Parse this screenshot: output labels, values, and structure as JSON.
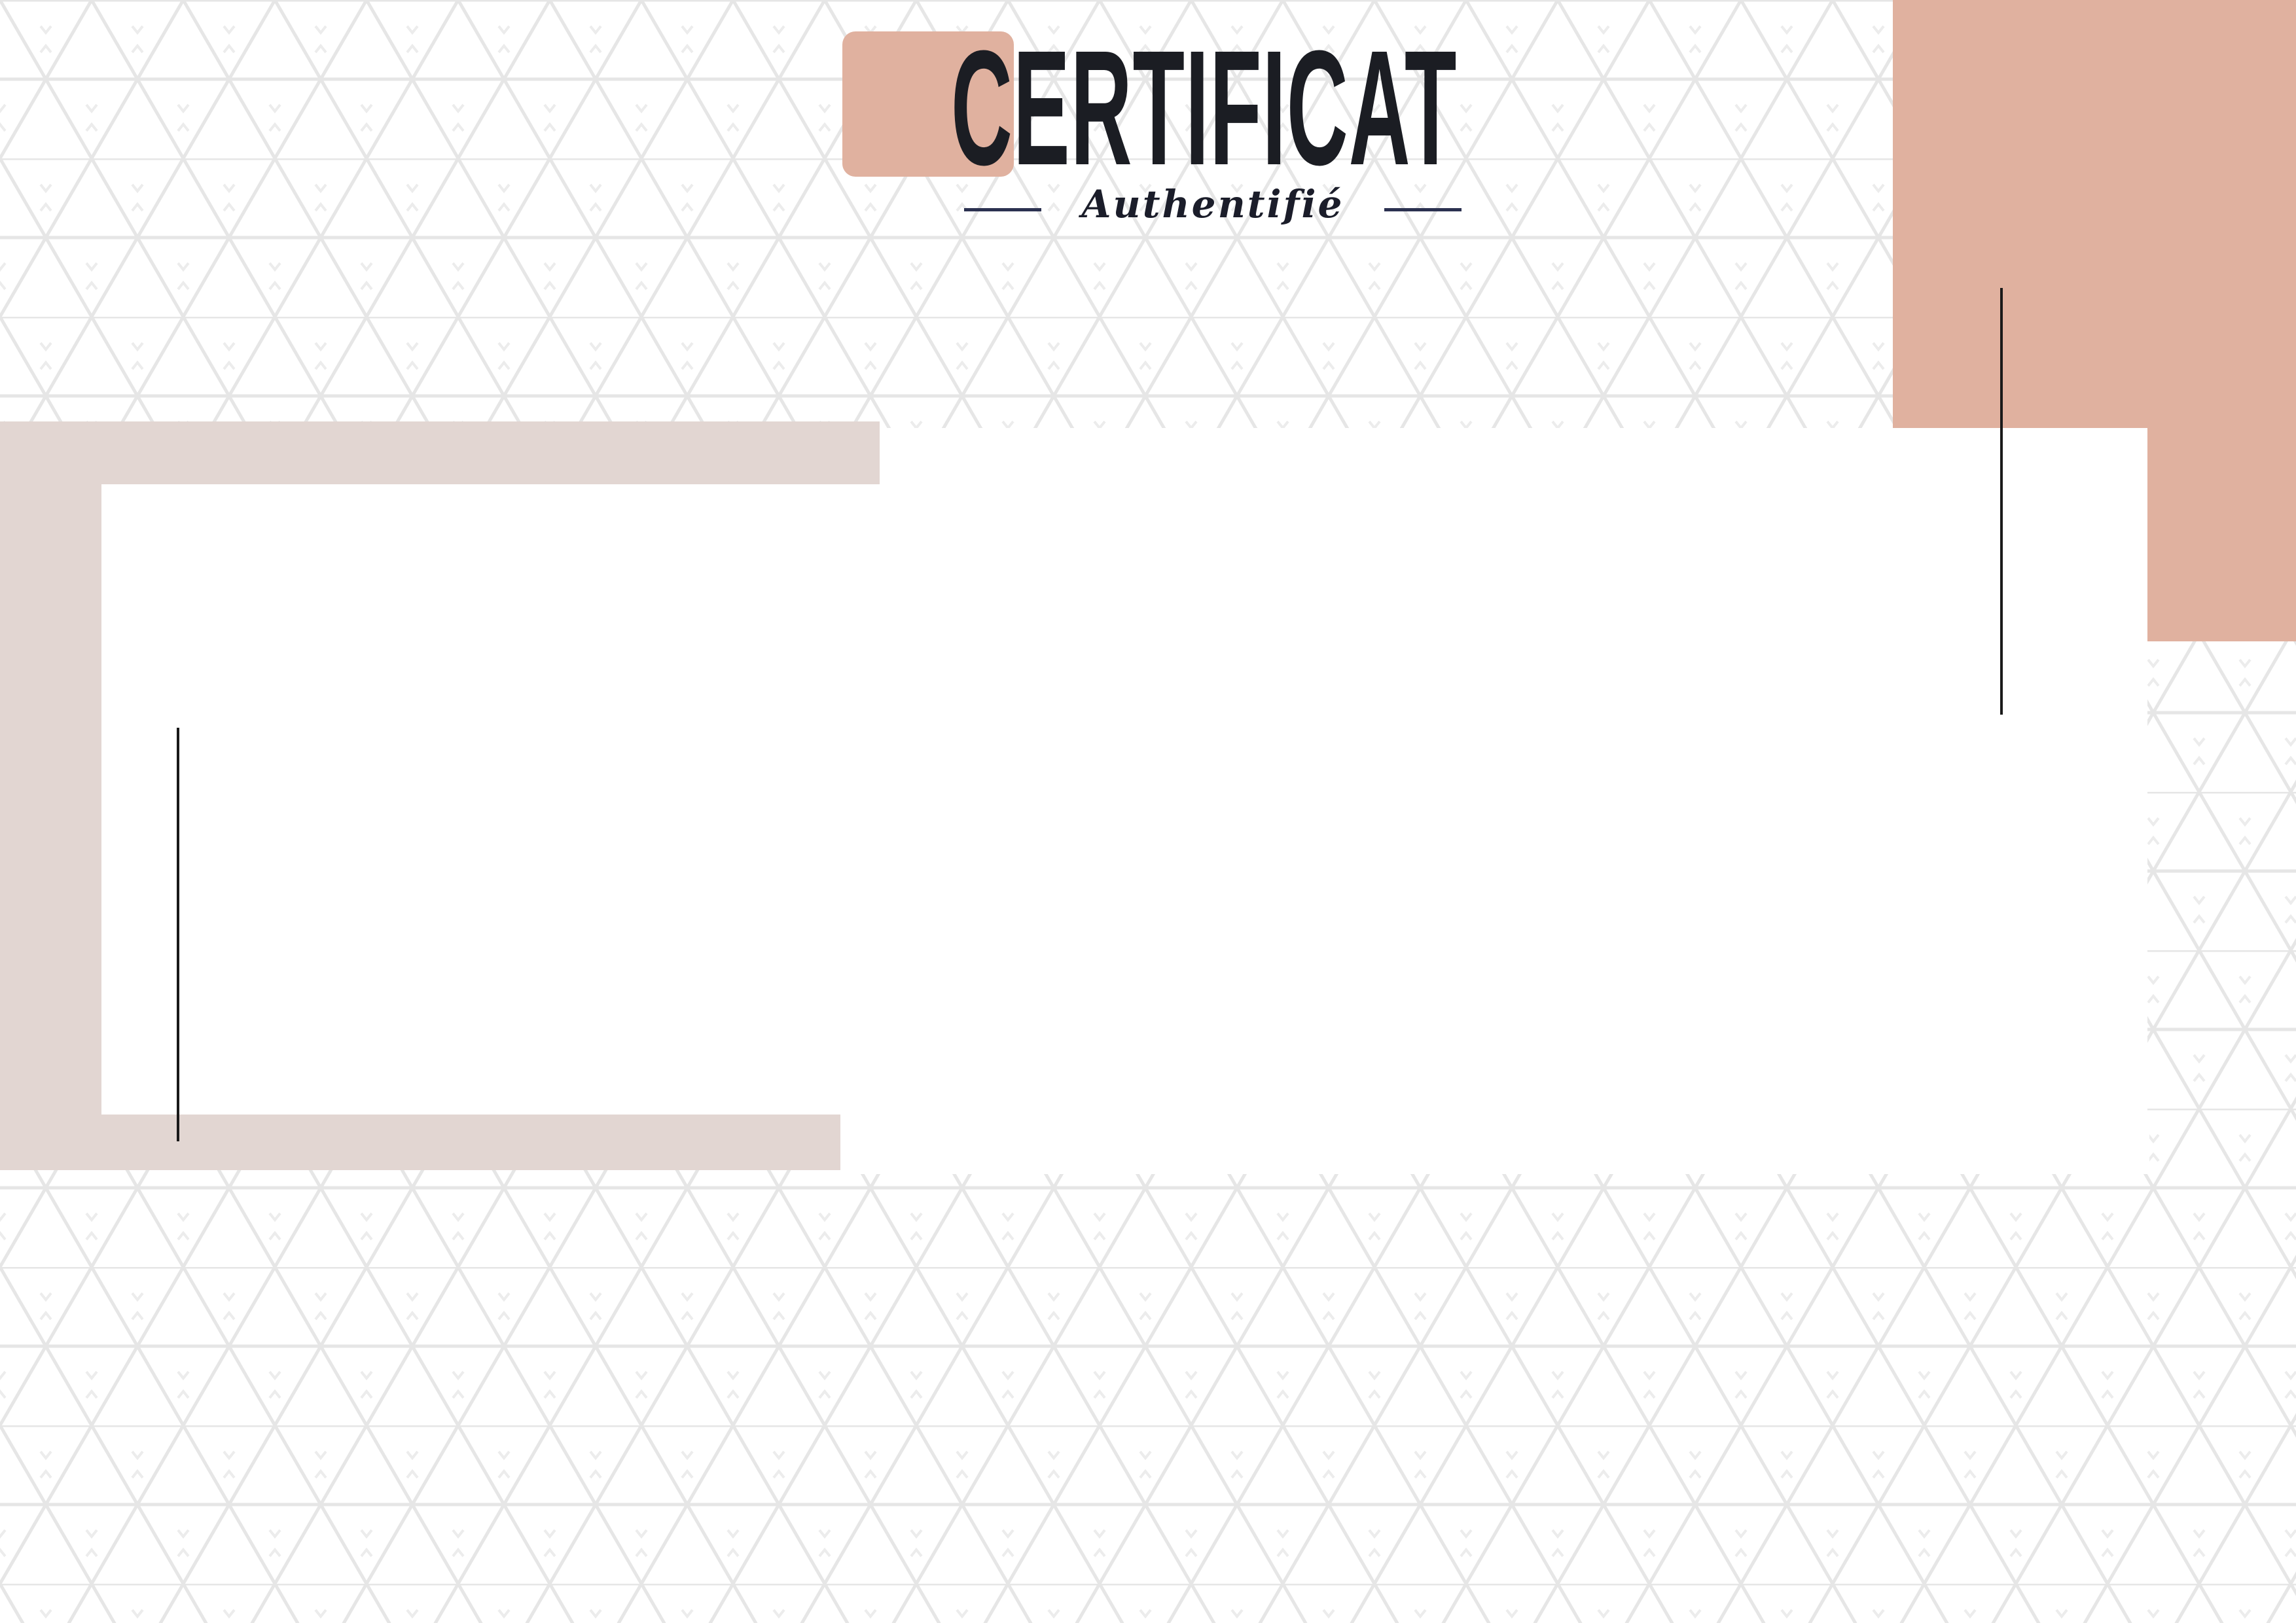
{
  "certificate": {
    "title": "CERTIFICAT",
    "subtitle": "Authentifié"
  },
  "colors": {
    "accent_peach": "#e0b19f",
    "accent_taupe": "#e2d6d2",
    "title_text": "#1b1d23",
    "subtitle_text": "#1b1d2a",
    "subtitle_rule": "#2b3150",
    "pattern_line": "#e6e6e6",
    "background": "#ffffff"
  },
  "icons": {
    "background_pattern": "triangle-grid-pattern"
  }
}
